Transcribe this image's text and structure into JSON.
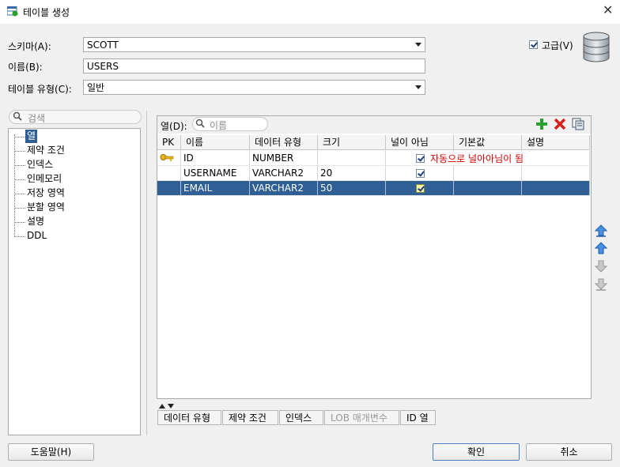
{
  "window": {
    "title": "테이블 생성",
    "close": "✕"
  },
  "form": {
    "schema_label": "스키마(A):",
    "schema_value": "SCOTT",
    "name_label": "이름(B):",
    "name_value": "USERS",
    "type_label": "테이블 유형(C):",
    "type_value": "일반",
    "advanced_label": "고급(V)",
    "advanced_checked": true
  },
  "tree": {
    "search_placeholder": "검색",
    "items": [
      "열",
      "제약 조건",
      "인덱스",
      "인메모리",
      "저장 영역",
      "분할 영역",
      "설명",
      "DDL"
    ]
  },
  "columns_panel": {
    "label": "열(D):",
    "search_placeholder": "이름",
    "headers": [
      "PK",
      "이름",
      "데이터 유형",
      "크기",
      "널이 아님",
      "기본값",
      "설명"
    ],
    "rows": [
      {
        "pk": true,
        "name": "ID",
        "type": "NUMBER",
        "size": "",
        "not_null": true,
        "default": "",
        "comment": "",
        "note": "자동으로 널아아님이 됨"
      },
      {
        "pk": false,
        "name": "USERNAME",
        "type": "VARCHAR2",
        "size": "20",
        "not_null": true,
        "default": "",
        "comment": ""
      },
      {
        "pk": false,
        "name": "EMAIL",
        "type": "VARCHAR2",
        "size": "50",
        "not_null": true,
        "default": "",
        "comment": "",
        "selected": true
      }
    ]
  },
  "bottom_tabs": [
    {
      "label": "데이터 유형",
      "enabled": true
    },
    {
      "label": "제약 조건",
      "enabled": true
    },
    {
      "label": "인덱스",
      "enabled": true
    },
    {
      "label": "LOB 매개변수",
      "enabled": false
    },
    {
      "label": "ID 열",
      "enabled": true
    }
  ],
  "buttons": {
    "help": "도움말(H)",
    "ok": "확인",
    "cancel": "취소"
  },
  "colors": {
    "selection": "#2f5f94",
    "add": "#2ca02c",
    "delete": "#d62020",
    "note": "#d00000"
  }
}
